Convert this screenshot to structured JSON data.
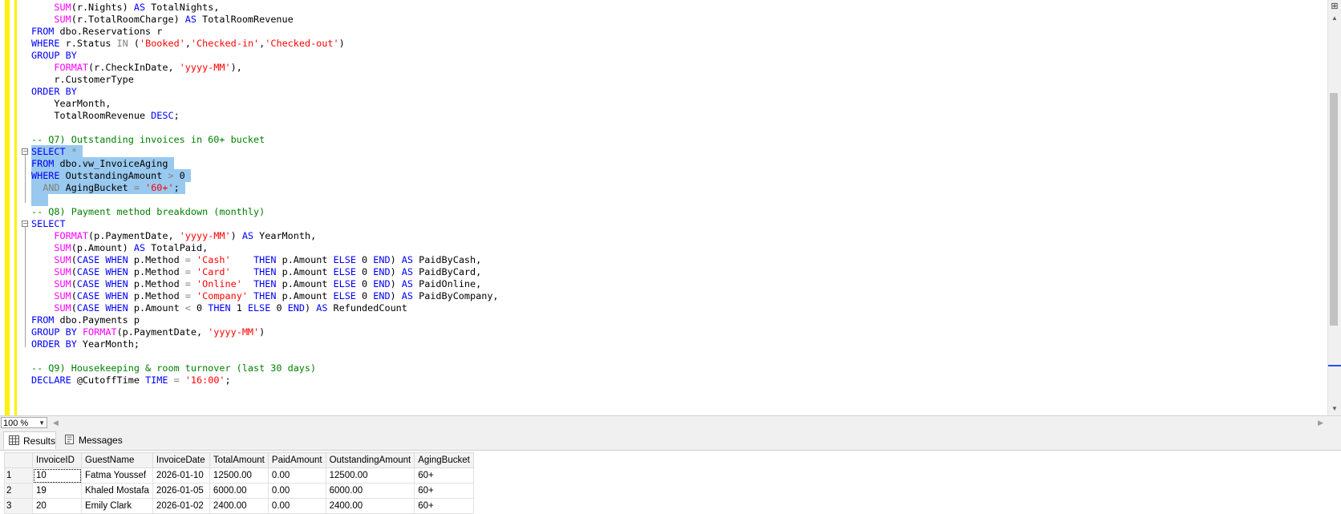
{
  "editor": {
    "lines": [
      [
        [
          "    ",
          ""
        ],
        [
          "SUM",
          "fn"
        ],
        [
          "(r.Nights) ",
          ""
        ],
        [
          "AS",
          "kw"
        ],
        [
          " TotalNights,",
          ""
        ]
      ],
      [
        [
          "    ",
          ""
        ],
        [
          "SUM",
          "fn"
        ],
        [
          "(r.TotalRoomCharge) ",
          ""
        ],
        [
          "AS",
          "kw"
        ],
        [
          " TotalRoomRevenue",
          ""
        ]
      ],
      [
        [
          "FROM",
          "kw"
        ],
        [
          " dbo.Reservations r",
          ""
        ]
      ],
      [
        [
          "WHERE",
          "kw"
        ],
        [
          " r.Status ",
          ""
        ],
        [
          "IN",
          "op"
        ],
        [
          " (",
          ""
        ],
        [
          "'Booked'",
          "str"
        ],
        [
          ",",
          ""
        ],
        [
          "'Checked-in'",
          "str"
        ],
        [
          ",",
          ""
        ],
        [
          "'Checked-out'",
          "str"
        ],
        [
          ")",
          ""
        ]
      ],
      [
        [
          "GROUP BY",
          "kw"
        ]
      ],
      [
        [
          "    ",
          ""
        ],
        [
          "FORMAT",
          "fn"
        ],
        [
          "(r.CheckInDate, ",
          ""
        ],
        [
          "'yyyy-MM'",
          "str"
        ],
        [
          "),",
          ""
        ]
      ],
      [
        [
          "    r.CustomerType",
          ""
        ]
      ],
      [
        [
          "ORDER BY",
          "kw"
        ]
      ],
      [
        [
          "    YearMonth,",
          ""
        ]
      ],
      [
        [
          "    TotalRoomRevenue ",
          ""
        ],
        [
          "DESC",
          "kw"
        ],
        [
          ";",
          ""
        ]
      ],
      [],
      [
        [
          "-- Q7) Outstanding invoices in 60+ bucket",
          "cm"
        ]
      ],
      [
        [
          "SELECT",
          "kw"
        ],
        [
          " ",
          ""
        ],
        [
          "*",
          "op"
        ],
        [
          " ",
          ""
        ]
      ],
      [
        [
          "FROM",
          "kw"
        ],
        [
          " dbo.vw_InvoiceAging ",
          ""
        ]
      ],
      [
        [
          "WHERE",
          "kw"
        ],
        [
          " OutstandingAmount ",
          ""
        ],
        [
          ">",
          "op"
        ],
        [
          " 0 ",
          ""
        ]
      ],
      [
        [
          "  ",
          ""
        ],
        [
          "AND",
          "op"
        ],
        [
          " AgingBucket ",
          ""
        ],
        [
          "=",
          "op"
        ],
        [
          " ",
          ""
        ],
        [
          "'60+'",
          "str"
        ],
        [
          ";",
          ""
        ],
        [
          " ",
          ""
        ]
      ],
      [
        [
          "   ",
          ""
        ]
      ],
      [
        [
          "-- Q8) Payment method breakdown (monthly)",
          "cm"
        ]
      ],
      [
        [
          "SELECT",
          "kw"
        ]
      ],
      [
        [
          "    ",
          ""
        ],
        [
          "FORMAT",
          "fn"
        ],
        [
          "(p.PaymentDate, ",
          ""
        ],
        [
          "'yyyy-MM'",
          "str"
        ],
        [
          ") ",
          ""
        ],
        [
          "AS",
          "kw"
        ],
        [
          " YearMonth,",
          ""
        ]
      ],
      [
        [
          "    ",
          ""
        ],
        [
          "SUM",
          "fn"
        ],
        [
          "(p.Amount) ",
          ""
        ],
        [
          "AS",
          "kw"
        ],
        [
          " TotalPaid,",
          ""
        ]
      ],
      [
        [
          "    ",
          ""
        ],
        [
          "SUM",
          "fn"
        ],
        [
          "(",
          ""
        ],
        [
          "CASE WHEN",
          "kw"
        ],
        [
          " p.Method ",
          ""
        ],
        [
          "=",
          "op"
        ],
        [
          " ",
          ""
        ],
        [
          "'Cash'",
          "str"
        ],
        [
          "    ",
          ""
        ],
        [
          "THEN",
          "kw"
        ],
        [
          " p.Amount ",
          ""
        ],
        [
          "ELSE",
          "kw"
        ],
        [
          " 0 ",
          ""
        ],
        [
          "END",
          "kw"
        ],
        [
          ") ",
          ""
        ],
        [
          "AS",
          "kw"
        ],
        [
          " PaidByCash,",
          ""
        ]
      ],
      [
        [
          "    ",
          ""
        ],
        [
          "SUM",
          "fn"
        ],
        [
          "(",
          ""
        ],
        [
          "CASE WHEN",
          "kw"
        ],
        [
          " p.Method ",
          ""
        ],
        [
          "=",
          "op"
        ],
        [
          " ",
          ""
        ],
        [
          "'Card'",
          "str"
        ],
        [
          "    ",
          ""
        ],
        [
          "THEN",
          "kw"
        ],
        [
          " p.Amount ",
          ""
        ],
        [
          "ELSE",
          "kw"
        ],
        [
          " 0 ",
          ""
        ],
        [
          "END",
          "kw"
        ],
        [
          ") ",
          ""
        ],
        [
          "AS",
          "kw"
        ],
        [
          " PaidByCard,",
          ""
        ]
      ],
      [
        [
          "    ",
          ""
        ],
        [
          "SUM",
          "fn"
        ],
        [
          "(",
          ""
        ],
        [
          "CASE WHEN",
          "kw"
        ],
        [
          " p.Method ",
          ""
        ],
        [
          "=",
          "op"
        ],
        [
          " ",
          ""
        ],
        [
          "'Online'",
          "str"
        ],
        [
          "  ",
          ""
        ],
        [
          "THEN",
          "kw"
        ],
        [
          " p.Amount ",
          ""
        ],
        [
          "ELSE",
          "kw"
        ],
        [
          " 0 ",
          ""
        ],
        [
          "END",
          "kw"
        ],
        [
          ") ",
          ""
        ],
        [
          "AS",
          "kw"
        ],
        [
          " PaidOnline,",
          ""
        ]
      ],
      [
        [
          "    ",
          ""
        ],
        [
          "SUM",
          "fn"
        ],
        [
          "(",
          ""
        ],
        [
          "CASE WHEN",
          "kw"
        ],
        [
          " p.Method ",
          ""
        ],
        [
          "=",
          "op"
        ],
        [
          " ",
          ""
        ],
        [
          "'Company'",
          "str"
        ],
        [
          " ",
          ""
        ],
        [
          "THEN",
          "kw"
        ],
        [
          " p.Amount ",
          ""
        ],
        [
          "ELSE",
          "kw"
        ],
        [
          " 0 ",
          ""
        ],
        [
          "END",
          "kw"
        ],
        [
          ") ",
          ""
        ],
        [
          "AS",
          "kw"
        ],
        [
          " PaidByCompany,",
          ""
        ]
      ],
      [
        [
          "    ",
          ""
        ],
        [
          "SUM",
          "fn"
        ],
        [
          "(",
          ""
        ],
        [
          "CASE WHEN",
          "kw"
        ],
        [
          " p.Amount ",
          ""
        ],
        [
          "<",
          "op"
        ],
        [
          " 0 ",
          ""
        ],
        [
          "THEN",
          "kw"
        ],
        [
          " 1 ",
          ""
        ],
        [
          "ELSE",
          "kw"
        ],
        [
          " 0 ",
          ""
        ],
        [
          "END",
          "kw"
        ],
        [
          ") ",
          ""
        ],
        [
          "AS",
          "kw"
        ],
        [
          " RefundedCount",
          ""
        ]
      ],
      [
        [
          "FROM",
          "kw"
        ],
        [
          " dbo.Payments p",
          ""
        ]
      ],
      [
        [
          "GROUP BY",
          "kw"
        ],
        [
          " ",
          ""
        ],
        [
          "FORMAT",
          "fn"
        ],
        [
          "(p.PaymentDate, ",
          ""
        ],
        [
          "'yyyy-MM'",
          "str"
        ],
        [
          ")",
          ""
        ]
      ],
      [
        [
          "ORDER BY",
          "kw"
        ],
        [
          " YearMonth;",
          ""
        ]
      ],
      [],
      [
        [
          "-- Q9) Housekeeping & room turnover (last 30 days)",
          "cm"
        ]
      ],
      [
        [
          "DECLARE",
          "kw"
        ],
        [
          " @CutoffTime ",
          ""
        ],
        [
          "TIME",
          "kw"
        ],
        [
          " ",
          ""
        ],
        [
          "=",
          "op"
        ],
        [
          " ",
          ""
        ],
        [
          "'16:00'",
          "str"
        ],
        [
          ";",
          ""
        ]
      ]
    ]
  },
  "zoom": {
    "value": "100 %"
  },
  "tabs": {
    "results": "Results",
    "messages": "Messages"
  },
  "grid": {
    "columns": [
      "InvoiceID",
      "GuestName",
      "InvoiceDate",
      "TotalAmount",
      "PaidAmount",
      "OutstandingAmount",
      "AgingBucket"
    ],
    "rows": [
      {
        "num": "1",
        "cells": [
          "10",
          "Fatma Youssef",
          "2026-01-10",
          "12500.00",
          "0.00",
          "12500.00",
          "60+"
        ]
      },
      {
        "num": "2",
        "cells": [
          "19",
          "Khaled Mostafa",
          "2026-01-05",
          "6000.00",
          "0.00",
          "6000.00",
          "60+"
        ]
      },
      {
        "num": "3",
        "cells": [
          "20",
          "Emily Clark",
          "2026-01-02",
          "2400.00",
          "0.00",
          "2400.00",
          "60+"
        ]
      }
    ]
  }
}
